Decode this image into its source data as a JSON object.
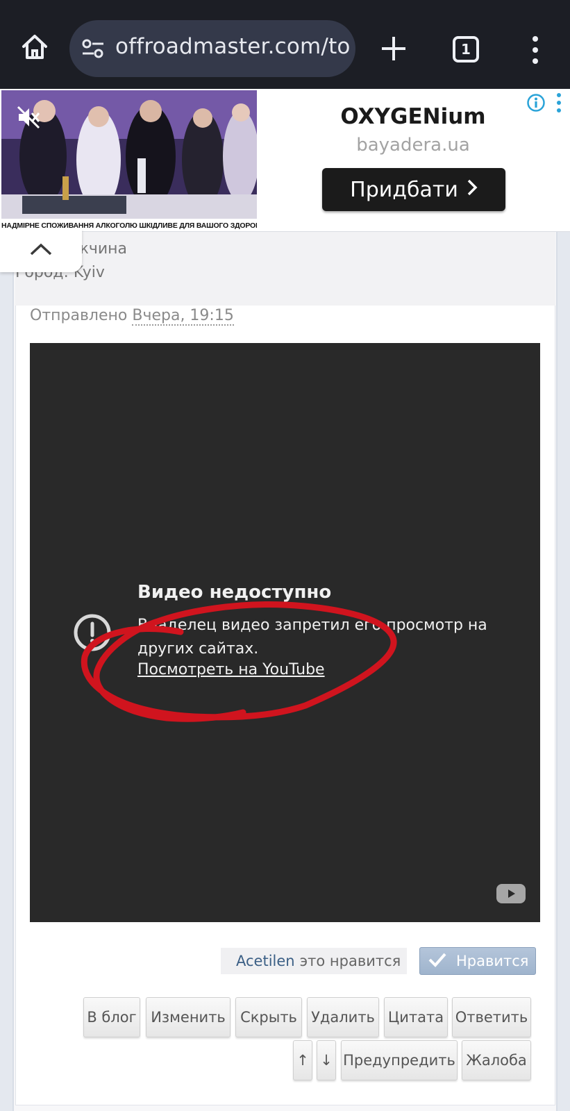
{
  "browser": {
    "url": "offroadmaster.com/to",
    "tab_count": "1",
    "icons": [
      "home-icon",
      "site-settings-icon",
      "new-tab-plus-icon",
      "tab-switcher-icon",
      "more-menu-icon"
    ]
  },
  "ad": {
    "disclaimer": "НАДМІРНЕ СПОЖИВАННЯ АЛКОГОЛЮ ШКІДЛИВЕ ДЛЯ ВАШОГО ЗДОРОВ'Я",
    "brand": "OXYGENium",
    "domain": "bayadera.ua",
    "cta": "Придбати",
    "icons": [
      "mute-icon",
      "info-icon",
      "more-icon"
    ]
  },
  "profile": {
    "gender_partial": "жчина",
    "city": "Город: Kyiv"
  },
  "post": {
    "sent_prefix": "Отправлено ",
    "sent_time": "Вчера, 19:15"
  },
  "video": {
    "title": "Видео недоступно",
    "message": "Владелец видео запретил его просмотр на других сайтах.",
    "link": "Посмотреть на YouTube",
    "annotation_color": "#d0141e"
  },
  "likes": {
    "user": "Acetilen",
    "suffix": "это нравится",
    "button": "Нравится"
  },
  "actions": {
    "row1": [
      "В блог",
      "Изменить",
      "Скрыть",
      "Удалить",
      "Цитата",
      "Ответить"
    ],
    "row2": [
      "↑",
      "↓",
      "Предупредить",
      "Жалоба"
    ]
  },
  "colors": {
    "browser_bar": "#1c1e25",
    "url_pill": "#34394a",
    "video_bg": "#292929",
    "like_button": "#a8bbd3",
    "link_blue": "#3b5f85"
  }
}
